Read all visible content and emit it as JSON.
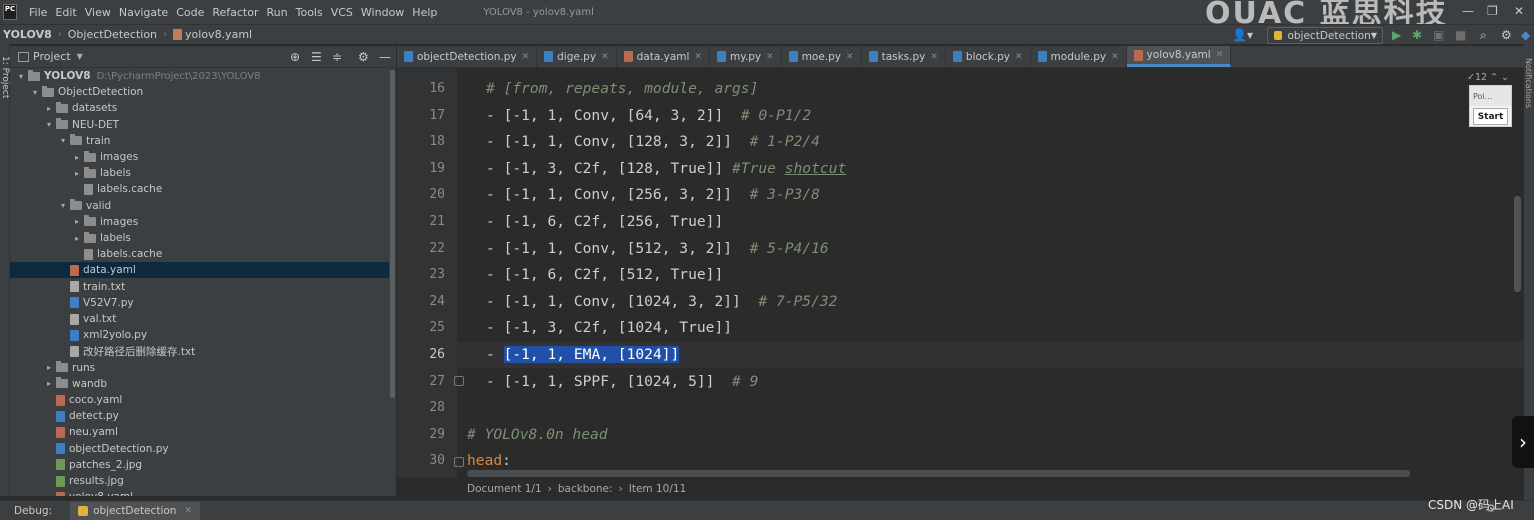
{
  "menubar": {
    "logo": "PC",
    "items": [
      "File",
      "Edit",
      "View",
      "Navigate",
      "Code",
      "Refactor",
      "Run",
      "Tools",
      "VCS",
      "Window",
      "Help"
    ],
    "window_title": "YOLOV8 - yolov8.yaml",
    "watermark": "OUAC 蓝思科技"
  },
  "navbar": {
    "project": "YOLOV8",
    "folder": "ObjectDetection",
    "file": "yolov8.yaml",
    "run_config": "objectDetection"
  },
  "left_strip": {
    "label": "1: Project"
  },
  "right_strip": {
    "label": "Notifications"
  },
  "project_panel": {
    "title": "Project",
    "tree": [
      {
        "label": "YOLOV8",
        "path": "D:\\PycharmProject\\2023\\YOLOV8",
        "type": "folder",
        "depth": 0,
        "arrow": "▾"
      },
      {
        "label": "ObjectDetection",
        "type": "folder",
        "depth": 1,
        "arrow": "▾"
      },
      {
        "label": "datasets",
        "type": "folder",
        "depth": 2,
        "arrow": "▸"
      },
      {
        "label": "NEU-DET",
        "type": "folder",
        "depth": 2,
        "arrow": "▾"
      },
      {
        "label": "train",
        "type": "folder",
        "depth": 3,
        "arrow": "▾"
      },
      {
        "label": "images",
        "type": "folder",
        "depth": 4,
        "arrow": "▸"
      },
      {
        "label": "labels",
        "type": "folder",
        "depth": 4,
        "arrow": "▸"
      },
      {
        "label": "labels.cache",
        "type": "cache",
        "depth": 4,
        "arrow": ""
      },
      {
        "label": "valid",
        "type": "folder",
        "depth": 3,
        "arrow": "▾"
      },
      {
        "label": "images",
        "type": "folder",
        "depth": 4,
        "arrow": "▸"
      },
      {
        "label": "labels",
        "type": "folder",
        "depth": 4,
        "arrow": "▸"
      },
      {
        "label": "labels.cache",
        "type": "cache",
        "depth": 4,
        "arrow": ""
      },
      {
        "label": "data.yaml",
        "type": "yaml",
        "depth": 3,
        "arrow": "",
        "selected": true
      },
      {
        "label": "train.txt",
        "type": "txt",
        "depth": 3,
        "arrow": ""
      },
      {
        "label": "V52V7.py",
        "type": "py",
        "depth": 3,
        "arrow": ""
      },
      {
        "label": "val.txt",
        "type": "txt",
        "depth": 3,
        "arrow": ""
      },
      {
        "label": "xml2yolo.py",
        "type": "py",
        "depth": 3,
        "arrow": ""
      },
      {
        "label": "改好路径后删除缓存.txt",
        "type": "txt",
        "depth": 3,
        "arrow": ""
      },
      {
        "label": "runs",
        "type": "folder",
        "depth": 2,
        "arrow": "▸"
      },
      {
        "label": "wandb",
        "type": "folder",
        "depth": 2,
        "arrow": "▸"
      },
      {
        "label": "coco.yaml",
        "type": "yaml",
        "depth": 2,
        "arrow": ""
      },
      {
        "label": "detect.py",
        "type": "py",
        "depth": 2,
        "arrow": ""
      },
      {
        "label": "neu.yaml",
        "type": "yaml",
        "depth": 2,
        "arrow": ""
      },
      {
        "label": "objectDetection.py",
        "type": "py",
        "depth": 2,
        "arrow": ""
      },
      {
        "label": "patches_2.jpg",
        "type": "img",
        "depth": 2,
        "arrow": ""
      },
      {
        "label": "results.jpg",
        "type": "img",
        "depth": 2,
        "arrow": ""
      },
      {
        "label": "yolov8.yaml",
        "type": "yaml",
        "depth": 2,
        "arrow": ""
      }
    ]
  },
  "editor_tabs": [
    {
      "label": "objectDetection.py",
      "type": "py"
    },
    {
      "label": "dige.py",
      "type": "py"
    },
    {
      "label": "data.yaml",
      "type": "yaml"
    },
    {
      "label": "my.py",
      "type": "py"
    },
    {
      "label": "moe.py",
      "type": "py"
    },
    {
      "label": "tasks.py",
      "type": "py"
    },
    {
      "label": "block.py",
      "type": "py"
    },
    {
      "label": "module.py",
      "type": "py"
    },
    {
      "label": "yolov8.yaml",
      "type": "yaml",
      "active": true
    }
  ],
  "editor": {
    "warning_count": "12",
    "lines": [
      {
        "n": "16",
        "code": "",
        "comment": "# [from, repeats, module, args]"
      },
      {
        "n": "17",
        "code": "- [-1, 1, Conv, [64, 3, 2]]  ",
        "comment": "# 0-P1/2"
      },
      {
        "n": "18",
        "code": "- [-1, 1, Conv, [128, 3, 2]]  ",
        "comment": "# 1-P2/4"
      },
      {
        "n": "19",
        "code": "- [-1, 3, C2f, [128, True]] ",
        "comment": "#True ",
        "comment2": "shotcut"
      },
      {
        "n": "20",
        "code": "- [-1, 1, Conv, [256, 3, 2]]  ",
        "comment": "# 3-P3/8"
      },
      {
        "n": "21",
        "code": "- [-1, 6, C2f, [256, True]]",
        "comment": ""
      },
      {
        "n": "22",
        "code": "- [-1, 1, Conv, [512, 3, 2]]  ",
        "comment": "# 5-P4/16"
      },
      {
        "n": "23",
        "code": "- [-1, 6, C2f, [512, True]]",
        "comment": ""
      },
      {
        "n": "24",
        "code": "- [-1, 1, Conv, [1024, 3, 2]]  ",
        "comment": "# 7-P5/32"
      },
      {
        "n": "25",
        "code": "- [-1, 3, C2f, [1024, True]]",
        "comment": ""
      },
      {
        "n": "26",
        "code": "- ",
        "selection": "[-1, 1, EMA, [1024]]",
        "comment": ""
      },
      {
        "n": "27",
        "code": "- [-1, 1, SPPF, [1024, 5]]  ",
        "comment": "# 9"
      },
      {
        "n": "28",
        "code": "",
        "comment": ""
      },
      {
        "n": "29",
        "code": "",
        "comment": "# YOLOv8.0n head"
      },
      {
        "n": "30",
        "keyword": "head",
        "code": ":",
        "comment": ""
      }
    ]
  },
  "popup": {
    "title": "Poi...",
    "button": "Start"
  },
  "breadcrumb": {
    "items": [
      "Document 1/1",
      "backbone:",
      "Item 10/11"
    ],
    "seps": [
      "›",
      "›"
    ]
  },
  "debug": {
    "label": "Debug:",
    "tab": "objectDetection"
  },
  "watermark_csdn": "CSDN @码上AI"
}
